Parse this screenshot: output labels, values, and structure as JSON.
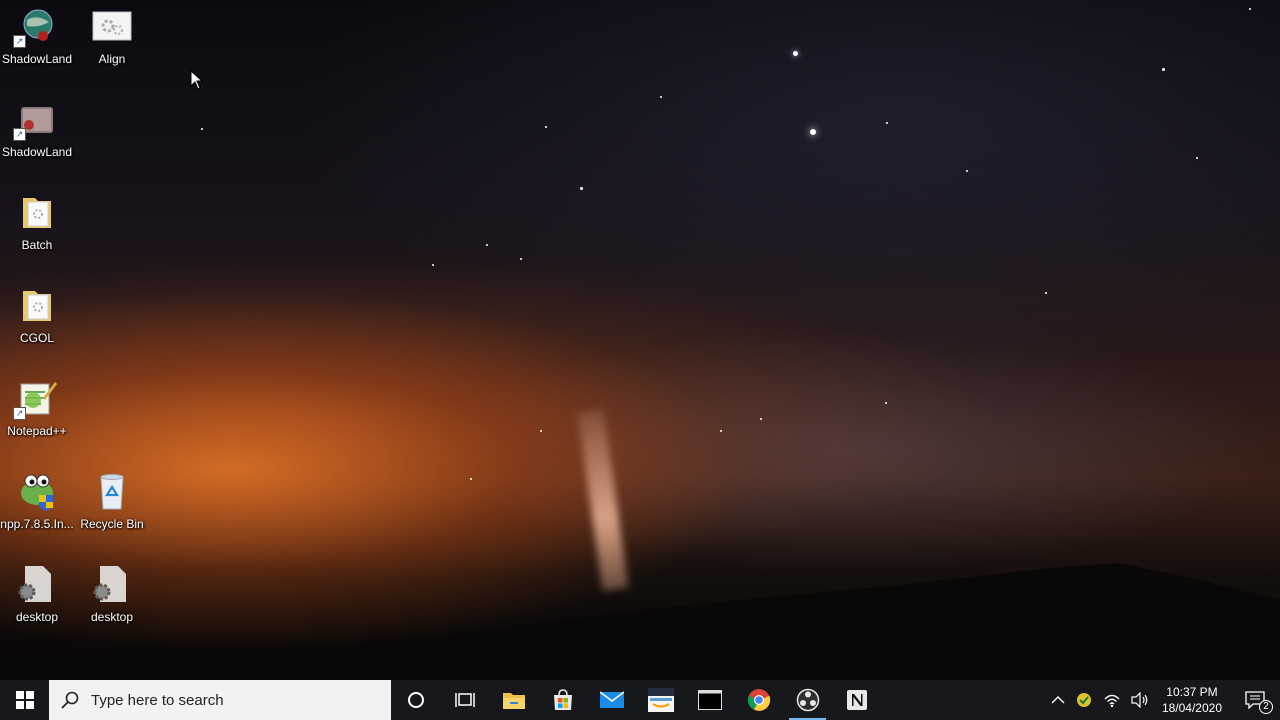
{
  "desktop": {
    "icons": [
      {
        "label": "ShadowLand",
        "icon": "globe-shortcut-icon"
      },
      {
        "label": "Align",
        "icon": "gear-image-icon"
      },
      {
        "label": "ShadowLand",
        "icon": "image-shortcut-icon"
      },
      {
        "label": "Batch",
        "icon": "folder-icon"
      },
      {
        "label": "CGOL",
        "icon": "folder-icon"
      },
      {
        "label": "Notepad++",
        "icon": "notepadplusplus-icon"
      },
      {
        "label": "npp.7.8.5.In...",
        "icon": "installer-icon"
      },
      {
        "label": "Recycle Bin",
        "icon": "recycle-bin-icon"
      },
      {
        "label": "desktop",
        "icon": "settings-file-icon"
      },
      {
        "label": "desktop",
        "icon": "settings-file-icon"
      }
    ]
  },
  "taskbar": {
    "search_placeholder": "Type here to search",
    "pinned": [
      "cortana-icon",
      "task-view-icon",
      "file-explorer-icon",
      "store-icon",
      "mail-icon",
      "amazon-icon",
      "terminal-icon",
      "chrome-icon",
      "obs-icon",
      "notion-icon"
    ],
    "active_app": "obs-icon",
    "tray": {
      "time": "10:37 PM",
      "date": "18/04/2020",
      "notification_count": "2"
    }
  },
  "colors": {
    "taskbar_bg": "#17181c",
    "accent": "#76b9ed",
    "search_bg": "#f2f2f2"
  }
}
